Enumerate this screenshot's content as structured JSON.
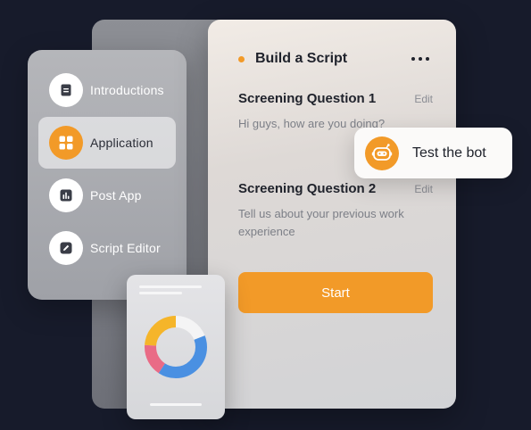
{
  "colors": {
    "accent": "#f29a28",
    "background": "#171b2b",
    "donut_yellow": "#f5b52a",
    "donut_blue": "#4a90e2",
    "donut_pink": "#e96b86",
    "donut_white": "#f4f4f5"
  },
  "sidebar": {
    "items": [
      {
        "label": "Introductions",
        "icon": "document-icon",
        "active": false
      },
      {
        "label": "Application",
        "icon": "grid-icon",
        "active": true
      },
      {
        "label": "Post App",
        "icon": "bar-chart-icon",
        "active": false
      },
      {
        "label": "Script Editor",
        "icon": "pencil-icon",
        "active": false
      }
    ]
  },
  "card": {
    "title": "Build a Script",
    "more_icon": "more-dots-icon",
    "questions": [
      {
        "title": "Screening Question 1",
        "edit": "Edit",
        "text": "Hi guys, how are you doing?"
      },
      {
        "title": "Screening Question 2",
        "edit": "Edit",
        "text": "Tell us about your previous work experience"
      }
    ],
    "start_label": "Start"
  },
  "bot": {
    "label": "Test the bot",
    "icon": "robot-icon"
  },
  "mini_chart": {
    "icon": "donut-chart-icon"
  }
}
